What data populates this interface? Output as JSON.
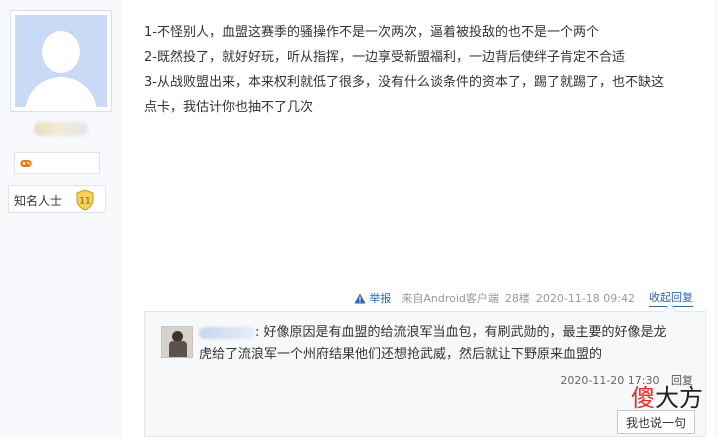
{
  "user": {
    "title": "知名人士",
    "level": "11"
  },
  "post": {
    "lines": [
      "1-不怪别人，血盟这赛季的骚操作不是一次两次，逼着被投敌的也不是一个两个",
      "2-既然投了，就好好玩，听从指挥，一边享受新盟福利，一边背后使绊子肯定不合适",
      "3-从战败盟出来，本来权利就低了很多，没有什么谈条件的资本了，踢了就踢了，也不缺这",
      "点卡，我估计你也抽不了几次"
    ],
    "meta": {
      "report": "举报",
      "source": "来自Android客户端",
      "floor": "28楼",
      "time": "2020-11-18 09:42",
      "collapse": "收起回复"
    }
  },
  "reply": {
    "text_line1": ": 好像原因是有血盟的给流浪军当血包，有刷武勋的，最主要的好像是龙",
    "text_line2": "虎给了流浪军一个州府结果他们还想抢武威，然后就让下野原来血盟的",
    "time": "2020-11-20 17:30",
    "reply_label": "回复",
    "say_button": "我也说一句"
  },
  "watermark": {
    "part1": "傻",
    "part2": "大方"
  },
  "colors": {
    "link": "#2d64b3",
    "sidebar_bg": "#f7f9fc",
    "reply_bg": "#f7f8fa",
    "watermark_red": "#e52b2b"
  }
}
